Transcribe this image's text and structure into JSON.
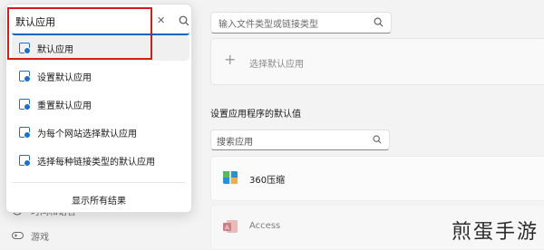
{
  "sidebar": {
    "time_language_label": "时间和语言",
    "games_label": "游戏"
  },
  "search_flyout": {
    "query": "默认应用",
    "clear_glyph": "✕",
    "results": [
      {
        "label": "默认应用"
      },
      {
        "label": "设置默认应用"
      },
      {
        "label": "重置默认应用"
      },
      {
        "label": "为每个网站选择默认应用"
      },
      {
        "label": "选择每种链接类型的默认应用"
      }
    ],
    "show_all_label": "显示所有结果"
  },
  "main": {
    "file_type_placeholder": "输入文件类型或链接类型",
    "choose_app_label": "选择默认应用",
    "section_title": "设置应用程序的默认值",
    "app_search_placeholder": "搜索应用",
    "apps": [
      {
        "name": "360压缩"
      },
      {
        "name": "Access"
      }
    ]
  },
  "watermark": "煎蛋手游",
  "colors": {
    "accent": "#0067c0",
    "highlight_box": "#d71c1c",
    "setting_icon": "#1f6fc6"
  }
}
